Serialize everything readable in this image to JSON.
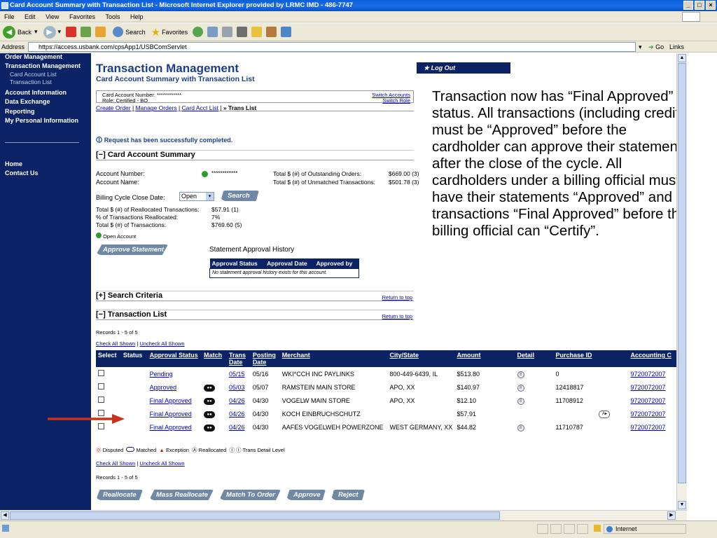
{
  "window": {
    "title": "Card Account Summary with Transaction List - Microsoft Internet Explorer provided by LRMC IMD - 486-7747"
  },
  "menu": [
    "File",
    "Edit",
    "View",
    "Favorites",
    "Tools",
    "Help"
  ],
  "toolbar": {
    "back": "Back",
    "search": "Search",
    "favorites": "Favorites"
  },
  "address": {
    "label": "Address",
    "url": "https://access.usbank.com/cpsApp1/USBComServlet",
    "go": "Go",
    "links": "Links"
  },
  "nav": {
    "order_mgmt": "Order Management",
    "txn_mgmt": "Transaction Management",
    "card_acct_list": "Card Account List",
    "txn_list": "Transaction List",
    "account_info": "Account Information",
    "data_exchange": "Data Exchange",
    "reporting": "Reporting",
    "my_personal": "My Personal Information",
    "home": "Home",
    "contact": "Contact Us"
  },
  "page": {
    "title": "Transaction Management",
    "subtitle": "Card Account Summary with Transaction List",
    "logout": "Log Out",
    "card_account_number_label": "Card Account Number:",
    "card_account_number_value": "************",
    "role_label": "Role:",
    "role_value": "Certified - BO",
    "switch_accounts": "Switch Accounts",
    "switch_role": "Switch Role",
    "crumbs": [
      "Create Order",
      "Manage Orders",
      "Card Acct List",
      "Trans List"
    ],
    "message": "Request has been successfully completed."
  },
  "summary": {
    "header": "Card Account Summary",
    "account_number_label": "Account Number:",
    "account_number_value": "************",
    "account_name_label": "Account Name:",
    "outstanding_label": "Total $ (#) of Outstanding Orders:",
    "outstanding_value": "$669.00 (3)",
    "unmatched_label": "Total $ (#) of Unmatched Transactions:",
    "unmatched_value": "$501.78 (3)",
    "billing_label": "Billing Cycle Close Date:",
    "billing_value": "Open",
    "search_button": "Search",
    "realloc_label": "Total $ (#) of Reallocated Transactions:",
    "realloc_value": "$57.91 (1)",
    "pct_label": "% of Transactions Reallocated:",
    "pct_value": "7%",
    "total_label": "Total $ (#) of Transactions:",
    "total_value": "$769.60 (5)",
    "open_account": "Open Account",
    "approve_statement": "Approve Statement",
    "history_title": "Statement Approval History",
    "history_cols": [
      "Approval Status",
      "Approval Date",
      "Approved by"
    ],
    "history_empty": "No statement approval history exists for this account."
  },
  "search_criteria": {
    "header": "Search Criteria",
    "return_top": "Return to top"
  },
  "txn": {
    "header": "Transaction List",
    "return_top": "Return to top",
    "records": "Records 1 - 5 of 5",
    "check_all": "Check All Shown",
    "uncheck_all": "Uncheck All Shown",
    "columns": [
      "Select",
      "Status",
      "Approval Status",
      "Match",
      "Trans Date",
      "Posting Date",
      "Merchant",
      "City/State",
      "Amount",
      "Detail",
      "Purchase ID",
      "Accounting C"
    ],
    "rows": [
      {
        "approval": "Pending",
        "match": false,
        "trans_date": "05/15",
        "post_date": "05/16",
        "merchant": "WKI*CCH INC PAYLINKS",
        "city": "800-449-6439, IL",
        "amount": "$513.80",
        "detail": true,
        "purchase_id": "0",
        "realloc": false,
        "acct": "9720072007"
      },
      {
        "approval": "Approved",
        "match": true,
        "trans_date": "05/03",
        "post_date": "05/07",
        "merchant": "RAMSTEIN MAIN STORE",
        "city": "APO, XX",
        "amount": "$140.97",
        "detail": true,
        "purchase_id": "12418817",
        "realloc": false,
        "acct": "9720072007"
      },
      {
        "approval": "Final Approved",
        "match": true,
        "trans_date": "04/26",
        "post_date": "04/30",
        "merchant": "VOGELW MAIN STORE",
        "city": "APO, XX",
        "amount": "$12.10",
        "detail": true,
        "purchase_id": "11708912",
        "realloc": false,
        "acct": "9720072007"
      },
      {
        "approval": "Final Approved",
        "match": true,
        "trans_date": "04/26",
        "post_date": "04/30",
        "merchant": "KOCH EINBRUCHSCHUTZ",
        "city": "",
        "amount": "$57.91",
        "detail": false,
        "purchase_id": "",
        "realloc": true,
        "acct": "9720072007"
      },
      {
        "approval": "Final Approved",
        "match": true,
        "trans_date": "04/26",
        "post_date": "04/30",
        "merchant": "AAFES VOGELWEH POWERZONE",
        "city": "WEST GERMANY, XX",
        "amount": "$44.82",
        "detail": true,
        "purchase_id": "11710787",
        "realloc": false,
        "acct": "9720072007"
      }
    ],
    "legend": [
      "Disputed",
      "Matched",
      "Exception",
      "Reallocated",
      "Trans Detail Level"
    ],
    "buttons": [
      "Reallocate",
      "Mass Reallocate",
      "Match To Order",
      "Approve",
      "Reject"
    ]
  },
  "annotation": "Transaction now has “Final Approved” status. All transactions (including credits) must be “Approved” before the cardholder can approve their statement after the close of the cycle. All cardholders under a billing official must have their statements “Approved” and all transactions “Final Approved” before the billing official can “Certify”.",
  "status": {
    "zone": "Internet"
  }
}
